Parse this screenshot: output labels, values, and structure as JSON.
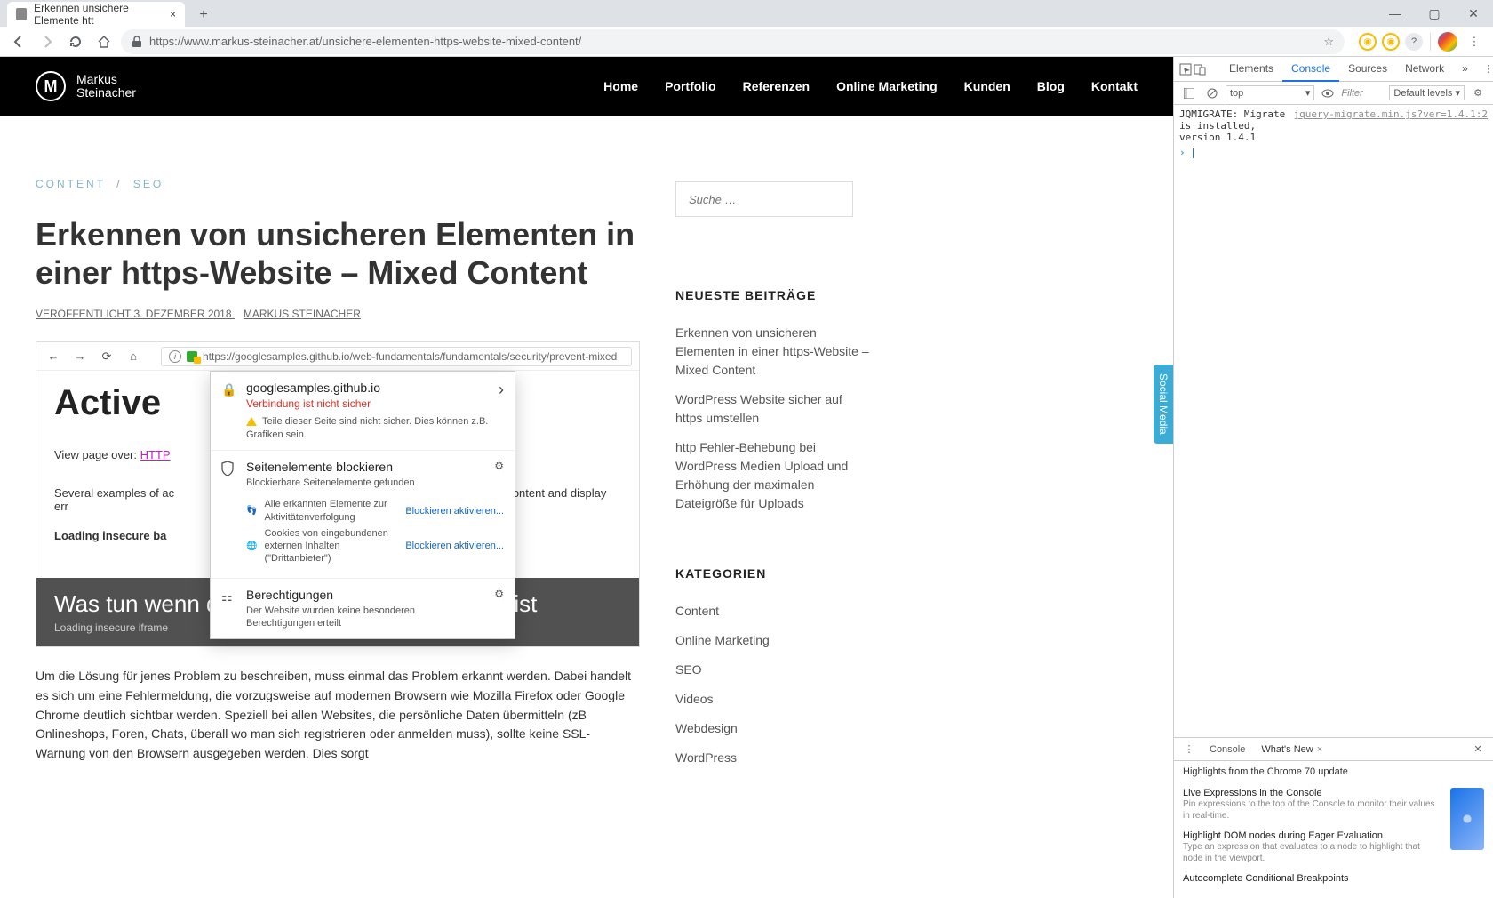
{
  "browser": {
    "tab_title": "Erkennen unsichere Elemente htt",
    "url": "https://www.markus-steinacher.at/unsichere-elementen-https-website-mixed-content/"
  },
  "site": {
    "brand_line1": "Markus",
    "brand_line2": "Steinacher",
    "nav": [
      "Home",
      "Portfolio",
      "Referenzen",
      "Online Marketing",
      "Kunden",
      "Blog",
      "Kontakt"
    ]
  },
  "article": {
    "crumb1": "CONTENT",
    "crumb2": "SEO",
    "title": "Erkennen von unsicheren Elementen in einer https-Website – Mixed Content",
    "meta_prefix": "VERÖFFENTLICHT ",
    "meta_date": "3. DEZEMBER 2018",
    "meta_author": "MARKUS STEINACHER",
    "embed": {
      "url": "https://googlesamples.github.io/web-fundamentals/fundamentals/security/prevent-mixed",
      "heading": "Active",
      "p1a": "View page over: ",
      "p1_link": "HTTP",
      "p2": "Several examples of ac",
      "p2b": "lock this content and display err",
      "bold": "Loading insecure ba",
      "caption_line1": "Was tun wenn die https-Website nicht sicher ist",
      "caption_line2": "Loading insecure iframe",
      "popup": {
        "host": "googlesamples.github.io",
        "red": "Verbindung ist nicht sicher",
        "warn": "Teile dieser Seite sind nicht sicher. Dies können z.B. Grafiken sein.",
        "sec2_title": "Seitenelemente blockieren",
        "sec2_sub": "Blockierbare Seitenelemente gefunden",
        "track": "Alle erkannten Elemente zur Aktivitätenverfolgung",
        "cookies": "Cookies von eingebundenen externen Inhalten (\"Drittanbieter\")",
        "activate": "Blockieren aktivieren...",
        "sec3_title": "Berechtigungen",
        "sec3_sub": "Der Website wurden keine besonderen Berechtigungen erteilt"
      }
    },
    "body_p": "Um die Lösung für jenes Problem zu beschreiben, muss einmal das Problem erkannt werden. Dabei handelt es sich um eine Fehlermeldung, die vorzugsweise auf modernen Browsern wie Mozilla Firefox oder Google Chrome deutlich sichtbar werden. Speziell bei allen Websites, die persönliche Daten übermitteln (zB Onlineshops, Foren, Chats, überall wo man sich registrieren oder anmelden muss), sollte keine SSL-Warnung von den Browsern ausgegeben werden. Dies sorgt"
  },
  "sidebar": {
    "search_placeholder": "Suche …",
    "h_recent": "NEUESTE BEITRÄGE",
    "recent": [
      "Erkennen von unsicheren Elementen in einer https-Website – Mixed Content",
      "WordPress Website sicher auf https umstellen",
      "http Fehler-Behebung bei WordPress Medien Upload und Erhöhung der maximalen Dateigröße für Uploads"
    ],
    "h_cat": "KATEGORIEN",
    "cats": [
      "Content",
      "Online Marketing",
      "SEO",
      "Videos",
      "Webdesign",
      "WordPress"
    ],
    "social": "Social Media"
  },
  "devtools": {
    "tabs": [
      "Elements",
      "Console",
      "Sources",
      "Network"
    ],
    "active_tab": "Console",
    "context": "top",
    "filter_placeholder": "Filter",
    "levels": "Default levels ▾",
    "msg": "JQMIGRATE: Migrate is installed, version 1.4.1",
    "msg_src": "jquery-migrate.min.js?ver=1.4.1:2",
    "bottom_tabs": {
      "t1": "Console",
      "t2": "What's New"
    },
    "highlights": "Highlights from the Chrome 70 update",
    "news": [
      {
        "title": "Live Expressions in the Console",
        "desc": "Pin expressions to the top of the Console to monitor their values in real-time."
      },
      {
        "title": "Highlight DOM nodes during Eager Evaluation",
        "desc": "Type an expression that evaluates to a node to highlight that node in the viewport."
      },
      {
        "title": "Autocomplete Conditional Breakpoints",
        "desc": ""
      }
    ]
  }
}
